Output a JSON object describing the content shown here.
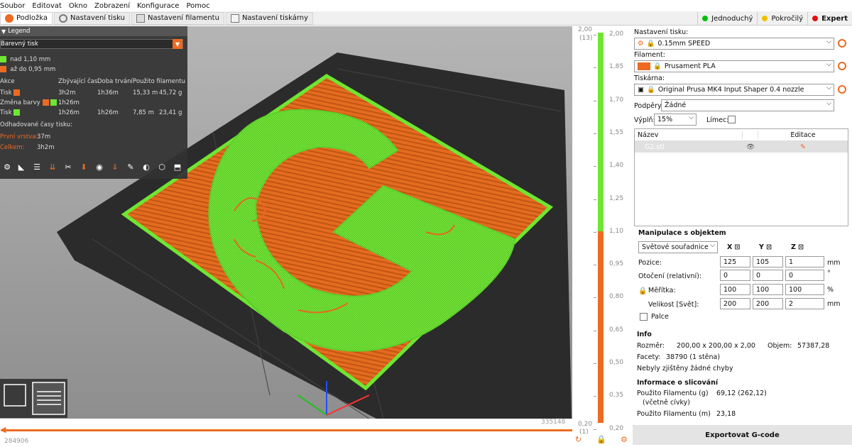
{
  "menu": [
    "Soubor",
    "Editovat",
    "Okno",
    "Zobrazení",
    "Konfigurace",
    "Pomoc"
  ],
  "tabs": [
    {
      "label": "Podložka"
    },
    {
      "label": "Nastavení tisku"
    },
    {
      "label": "Nastavení filamentu"
    },
    {
      "label": "Nastavení tiskárny"
    }
  ],
  "modes": [
    {
      "label": "Jednoduchý",
      "color": "#00c000"
    },
    {
      "label": "Pokročilý",
      "color": "#f0c000"
    },
    {
      "label": "Expert",
      "color": "#e01010"
    }
  ],
  "legend": {
    "title": "Legend",
    "view_type": "Barevný tisk",
    "ranges": [
      {
        "label": "nad 1,10 mm",
        "color": "#6ee632"
      },
      {
        "label": "až do 0,95 mm",
        "color": "#ed6b21"
      }
    ],
    "headers": [
      "Akce",
      "Zbývající čas",
      "Doba trvání",
      "Použito filamentu"
    ],
    "rows": [
      {
        "action": "Tisk",
        "remaining": "3h2m",
        "duration": "1h36m",
        "length": "15,33 m",
        "weight": "45,72 g",
        "swatch": "#ed6b21"
      },
      {
        "action": "Změna barvy",
        "remaining": "1h26m",
        "duration": "",
        "length": "",
        "weight": "",
        "swatch": "#ed6b21"
      },
      {
        "action": "Tisk",
        "remaining": "1h26m",
        "duration": "1h26m",
        "length": "7,85 m",
        "weight": "23,41 g",
        "swatch": "#6ee632"
      }
    ],
    "estimate_title": "Odhadované časy tisku:",
    "first_layer_label": "První vrstva:",
    "first_layer_value": "37m",
    "total_label": "Celkem:",
    "total_value": "3h2m"
  },
  "hslider": {
    "left_value": "284906",
    "right_value": "335148"
  },
  "vslider": {
    "top_value": "2,00",
    "top_layer": "(13)",
    "bottom_value": "0,20",
    "bottom_layer": "(1)",
    "ticks": [
      "2,00",
      "1,85",
      "1,70",
      "1,55",
      "1,40",
      "1,25",
      "1,10",
      "0,95",
      "0,80",
      "0,65",
      "0,50",
      "0,35",
      "0,20"
    ]
  },
  "right_panel": {
    "print_settings_label": "Nastavení tisku:",
    "print_settings_value": "0.15mm SPEED",
    "filament_label": "Filament:",
    "filament_value": "Prusament PLA",
    "filament_color": "#ed6b21",
    "printer_label": "Tiskárna:",
    "printer_value": "Original Prusa MK4 Input Shaper 0.4 nozzle",
    "supports_label": "Podpěry:",
    "supports_value": "Žádné",
    "infill_label": "Výplň:",
    "infill_value": "15%",
    "brim_label": "Límec:",
    "objects_col_name": "Název",
    "objects_col_edit": "Editace",
    "object_name": "G2.stl",
    "manip_title": "Manipulace s objektem",
    "coord_system": "Světové souřadnice",
    "axis_x": "X",
    "axis_y": "Y",
    "axis_z": "Z",
    "position_label": "Pozice:",
    "position": [
      "125",
      "105",
      "1"
    ],
    "rotation_label": "Otočení (relativní):",
    "rotation": [
      "0",
      "0",
      "0"
    ],
    "scale_label": "Měřítka:",
    "scale": [
      "100",
      "100",
      "100"
    ],
    "size_label": "Velikost [Svět]:",
    "size": [
      "200",
      "200",
      "2"
    ],
    "unit_mm": "mm",
    "unit_deg": "°",
    "unit_pct": "%",
    "inches_label": "Palce",
    "info_title": "Info",
    "size_info_label": "Rozměr:",
    "size_info_value": "200,00 x 200,00 x 2,00",
    "volume_label": "Objem:",
    "volume_value": "57387,28",
    "facets_label": "Facety:",
    "facets_value": "38790 (1 stěna)",
    "errors_text": "Nebyly zjištěny žádné chyby",
    "slice_title": "Informace o slicování",
    "filament_g_label": "Použito Filamentu (g)",
    "filament_g_value": "69,12 (262,12)",
    "spool_note": "(včetně cívky)",
    "filament_m_label": "Použito Filamentu (m)",
    "filament_m_value": "23,18",
    "export_label": "Exportovat G-code"
  }
}
